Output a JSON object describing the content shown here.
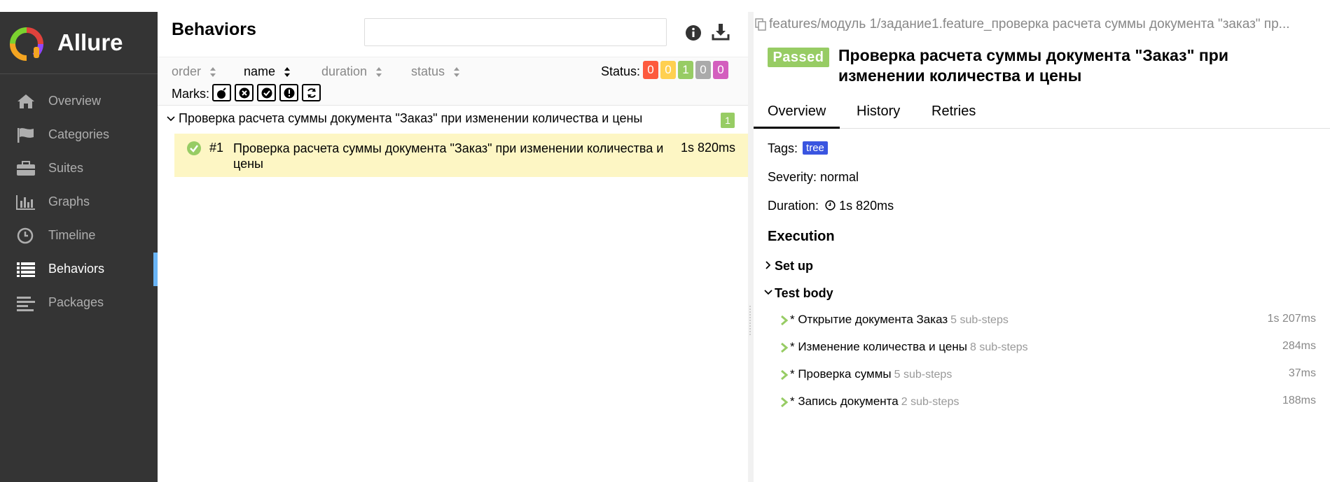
{
  "app": {
    "name": "Allure"
  },
  "sidebar": {
    "items": [
      {
        "label": "Overview",
        "icon": "home-icon"
      },
      {
        "label": "Categories",
        "icon": "flag-icon"
      },
      {
        "label": "Suites",
        "icon": "briefcase-icon"
      },
      {
        "label": "Graphs",
        "icon": "bar-chart-icon"
      },
      {
        "label": "Timeline",
        "icon": "clock-icon"
      },
      {
        "label": "Behaviors",
        "icon": "list-icon",
        "active": true
      },
      {
        "label": "Packages",
        "icon": "align-left-icon"
      }
    ]
  },
  "behaviors": {
    "title": "Behaviors",
    "search": {
      "value": "",
      "placeholder": ""
    },
    "sort": {
      "order": "order",
      "name": "name",
      "duration": "duration",
      "status": "status",
      "active": "name"
    },
    "status_label": "Status:",
    "status_counts": [
      {
        "value": "0",
        "color": "#fd5a3e"
      },
      {
        "value": "0",
        "color": "#ffd050"
      },
      {
        "value": "1",
        "color": "#97cc64"
      },
      {
        "value": "0",
        "color": "#aaaaaa"
      },
      {
        "value": "0",
        "color": "#d35ebe"
      }
    ],
    "marks_label": "Marks:",
    "marks": [
      "bomb-icon",
      "times-circle-icon",
      "check-circle-icon",
      "exclamation-icon",
      "refresh-icon"
    ],
    "group": {
      "title": "Проверка расчета суммы документа \"Заказ\" при изменении количества и цены",
      "count": "1"
    },
    "test": {
      "number": "#1",
      "title": "Проверка расчета суммы документа \"Заказ\" при изменении количества и цены",
      "duration": "1s 820ms"
    }
  },
  "detail": {
    "breadcrumb": "features/модуль 1/задание1.feature_проверка расчета суммы документа \"заказ\" пр...",
    "status": "Passed",
    "title": "Проверка расчета суммы документа \"Заказ\" при изменении количества и цены",
    "tabs": [
      "Overview",
      "History",
      "Retries"
    ],
    "tags_label": "Tags:",
    "tag": "tree",
    "severity": "Severity: normal",
    "duration_label": "Duration:",
    "duration": "1s 820ms",
    "execution_title": "Execution",
    "setup": "Set up",
    "test_body": "Test body",
    "steps": [
      {
        "name": "* Открытие документа Заказ",
        "sub": "5 sub-steps",
        "duration": "1s 207ms"
      },
      {
        "name": "* Изменение количества и цены",
        "sub": "8 sub-steps",
        "duration": "284ms"
      },
      {
        "name": "* Проверка суммы",
        "sub": "5 sub-steps",
        "duration": "37ms"
      },
      {
        "name": "* Запись документа",
        "sub": "2 sub-steps",
        "duration": "188ms"
      }
    ]
  },
  "colors": {
    "sidebar_bg": "#343434",
    "active_indicator": "#6ab5f6",
    "passed": "#97cc64",
    "selected_row": "#fdf6c4",
    "tag": "#3a55e0"
  }
}
